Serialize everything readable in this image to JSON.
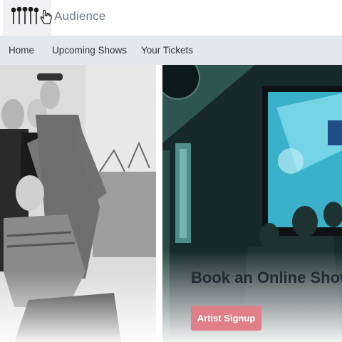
{
  "header": {
    "brand": "Audience",
    "logo_icon": "microphones-logo-icon",
    "cursor_icon": "hand-pointer-icon"
  },
  "nav": {
    "items": [
      {
        "label": "Home"
      },
      {
        "label": "Upcoming Shows"
      },
      {
        "label": "Your Tickets"
      }
    ]
  },
  "hero": {
    "heading": "Book an Online Show",
    "button_label": "Artist Signup",
    "button_color": "#e07f8a"
  },
  "colors": {
    "navbar_bg": "#e4e8ee",
    "brand_text": "#707a86",
    "heading_text": "#1f2b33"
  }
}
